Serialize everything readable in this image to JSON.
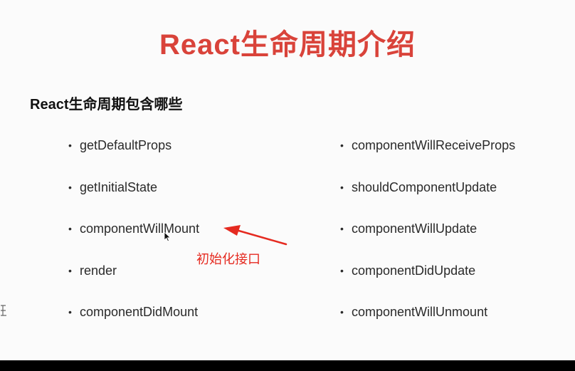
{
  "slide": {
    "title": "React生命周期介绍",
    "subtitle": "React生命周期包含哪些",
    "left_items": [
      "getDefaultProps",
      "getInitialState",
      "componentWillMount",
      "render",
      "componentDidMount"
    ],
    "right_items": [
      "componentWillReceiveProps",
      "shouldComponentUpdate",
      "componentWillUpdate",
      "componentDidUpdate",
      "componentWillUnmount"
    ],
    "annotation": "初始化接口",
    "bullet": "•"
  },
  "colors": {
    "title": "#d9433a",
    "annotation": "#e52a20",
    "arrow": "#e52a20",
    "background": "#fbfbfb"
  },
  "icons": {
    "cursor": "mouse-pointer-icon",
    "arrow": "red-annotation-arrow-icon"
  }
}
